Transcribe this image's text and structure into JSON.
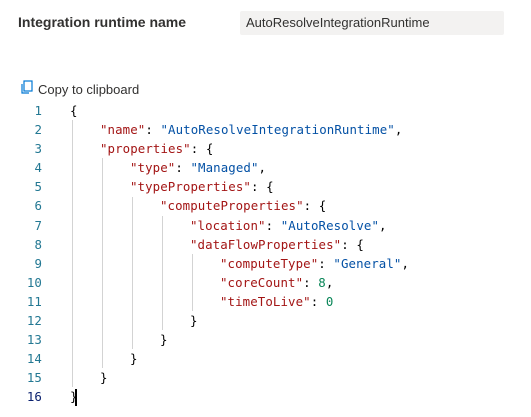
{
  "form": {
    "label": "Integration runtime name",
    "value": "AutoResolveIntegrationRuntime"
  },
  "copy": {
    "label": "Copy to clipboard",
    "icon": "copy-icon"
  },
  "code_lines": [
    {
      "n": "1",
      "indent": 0,
      "tokens": [
        {
          "t": "{",
          "c": "punct"
        }
      ]
    },
    {
      "n": "2",
      "indent": 1,
      "tokens": [
        {
          "t": "\"name\"",
          "c": "key"
        },
        {
          "t": ": ",
          "c": "punct"
        },
        {
          "t": "\"AutoResolveIntegrationRuntime\"",
          "c": "str"
        },
        {
          "t": ",",
          "c": "punct"
        }
      ]
    },
    {
      "n": "3",
      "indent": 1,
      "tokens": [
        {
          "t": "\"properties\"",
          "c": "key"
        },
        {
          "t": ": {",
          "c": "punct"
        }
      ]
    },
    {
      "n": "4",
      "indent": 2,
      "tokens": [
        {
          "t": "\"type\"",
          "c": "key"
        },
        {
          "t": ": ",
          "c": "punct"
        },
        {
          "t": "\"Managed\"",
          "c": "str"
        },
        {
          "t": ",",
          "c": "punct"
        }
      ]
    },
    {
      "n": "5",
      "indent": 2,
      "tokens": [
        {
          "t": "\"typeProperties\"",
          "c": "key"
        },
        {
          "t": ": {",
          "c": "punct"
        }
      ]
    },
    {
      "n": "6",
      "indent": 3,
      "tokens": [
        {
          "t": "\"computeProperties\"",
          "c": "key"
        },
        {
          "t": ": {",
          "c": "punct"
        }
      ]
    },
    {
      "n": "7",
      "indent": 4,
      "tokens": [
        {
          "t": "\"location\"",
          "c": "key"
        },
        {
          "t": ": ",
          "c": "punct"
        },
        {
          "t": "\"AutoResolve\"",
          "c": "str"
        },
        {
          "t": ",",
          "c": "punct"
        }
      ]
    },
    {
      "n": "8",
      "indent": 4,
      "tokens": [
        {
          "t": "\"dataFlowProperties\"",
          "c": "key"
        },
        {
          "t": ": {",
          "c": "punct"
        }
      ]
    },
    {
      "n": "9",
      "indent": 5,
      "tokens": [
        {
          "t": "\"computeType\"",
          "c": "key"
        },
        {
          "t": ": ",
          "c": "punct"
        },
        {
          "t": "\"General\"",
          "c": "str"
        },
        {
          "t": ",",
          "c": "punct"
        }
      ]
    },
    {
      "n": "10",
      "indent": 5,
      "tokens": [
        {
          "t": "\"coreCount\"",
          "c": "key"
        },
        {
          "t": ": ",
          "c": "punct"
        },
        {
          "t": "8",
          "c": "num"
        },
        {
          "t": ",",
          "c": "punct"
        }
      ]
    },
    {
      "n": "11",
      "indent": 5,
      "tokens": [
        {
          "t": "\"timeToLive\"",
          "c": "key"
        },
        {
          "t": ": ",
          "c": "punct"
        },
        {
          "t": "0",
          "c": "num"
        }
      ]
    },
    {
      "n": "12",
      "indent": 4,
      "tokens": [
        {
          "t": "}",
          "c": "punct"
        }
      ]
    },
    {
      "n": "13",
      "indent": 3,
      "tokens": [
        {
          "t": "}",
          "c": "punct"
        }
      ]
    },
    {
      "n": "14",
      "indent": 2,
      "tokens": [
        {
          "t": "}",
          "c": "punct"
        }
      ]
    },
    {
      "n": "15",
      "indent": 1,
      "tokens": [
        {
          "t": "}",
          "c": "punct"
        }
      ]
    },
    {
      "n": "16",
      "indent": 0,
      "tokens": [
        {
          "t": "}",
          "c": "punct"
        }
      ],
      "active": true
    }
  ],
  "colors": {
    "key": "#a31515",
    "string": "#0451a5",
    "number": "#098658",
    "line_number": "#237893",
    "field_background": "#f3f2f1"
  }
}
